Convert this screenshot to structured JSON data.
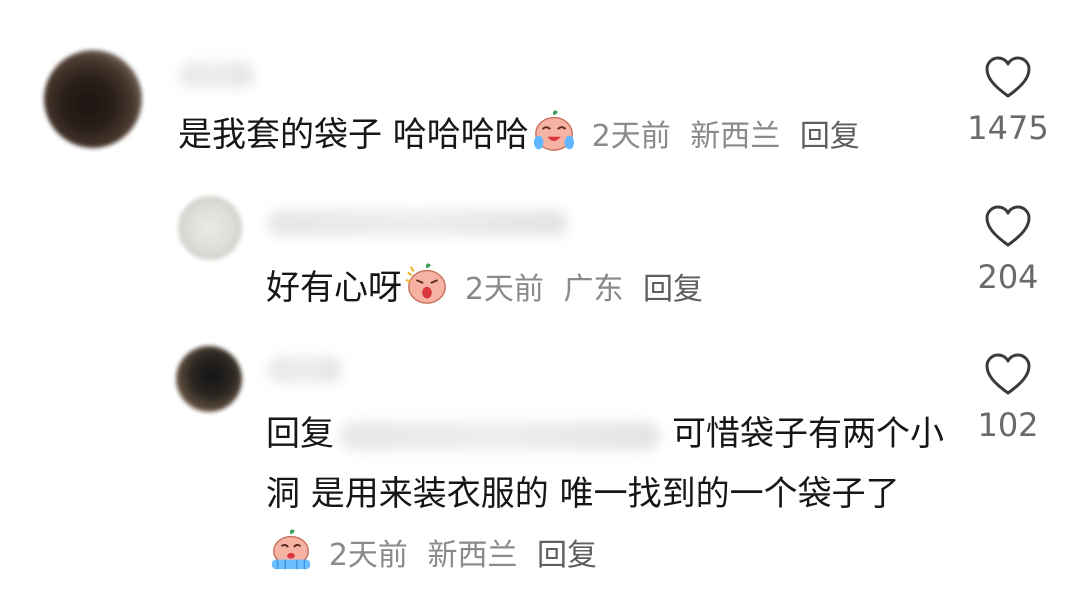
{
  "comments": [
    {
      "text": "是我套的袋子 哈哈哈哈",
      "emoji": "laughing-crying-face",
      "time": "2天前",
      "location": "新西兰",
      "reply_label": "回复",
      "likes": "1475"
    },
    {
      "text": "好有心呀",
      "emoji": "shouting-face",
      "time": "2天前",
      "location": "广东",
      "reply_label": "回复",
      "likes": "204"
    },
    {
      "prefix": "回复",
      "text": "可惜袋子有两个小洞 是用来装衣服的 唯一找到的一个袋子了",
      "emoji": "crying-face",
      "time": "2天前",
      "location": "新西兰",
      "reply_label": "回复",
      "likes": "102"
    }
  ],
  "icons": {
    "like": "heart-outline-icon"
  },
  "colors": {
    "text": "#161616",
    "meta": "#8a8a8a",
    "like_count": "#6a6a6a"
  }
}
